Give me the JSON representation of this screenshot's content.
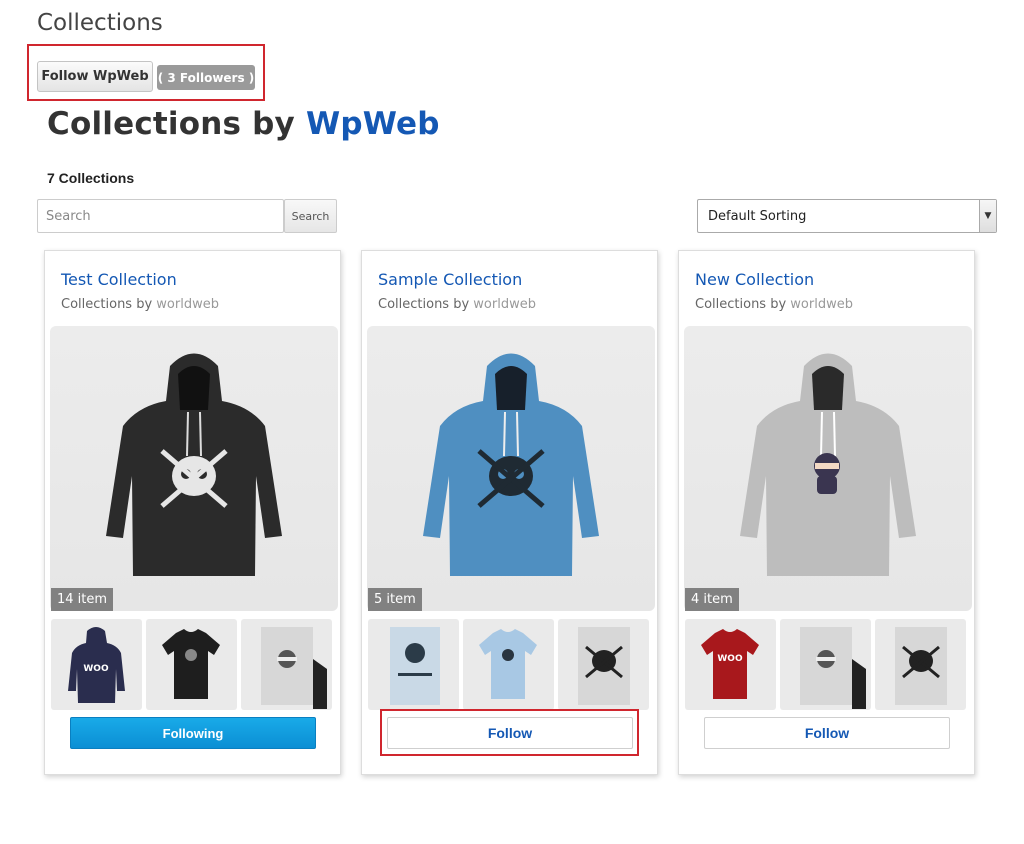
{
  "page": {
    "heading": "Collections"
  },
  "author": {
    "follow_label": "Follow WpWeb",
    "followers_label": "( 3 Followers )",
    "title_prefix": "Collections by ",
    "name": "WpWeb"
  },
  "summary": {
    "count_label": "7 Collections"
  },
  "search": {
    "placeholder": "Search",
    "button_label": "Search"
  },
  "sort": {
    "selected": "Default Sorting"
  },
  "colors": {
    "accent": "#1458b4",
    "highlight": "#d0262e",
    "following_btn": "#0b8fd4"
  },
  "collections": [
    {
      "title": "Test Collection",
      "byline_prefix": "Collections by ",
      "author": "worldweb",
      "item_count": "14 item",
      "follow_label": "Following",
      "hoodie_color": "#2b2b2b",
      "thumbs": [
        "navy-hoodie-woo",
        "black-tshirt-skull",
        "ninja-poster"
      ]
    },
    {
      "title": "Sample Collection",
      "byline_prefix": "Collections by ",
      "author": "worldweb",
      "item_count": "5 item",
      "follow_label": "Follow",
      "hoodie_color": "#4f8fc1",
      "thumbs": [
        "blue-poster",
        "light-blue-tshirt",
        "skull-poster"
      ]
    },
    {
      "title": "New Collection",
      "byline_prefix": "Collections by ",
      "author": "worldweb",
      "item_count": "4 item",
      "follow_label": "Follow",
      "hoodie_color": "#bdbdbd",
      "thumbs": [
        "red-tshirt-woo",
        "ninja-poster",
        "skull-poster"
      ]
    }
  ]
}
